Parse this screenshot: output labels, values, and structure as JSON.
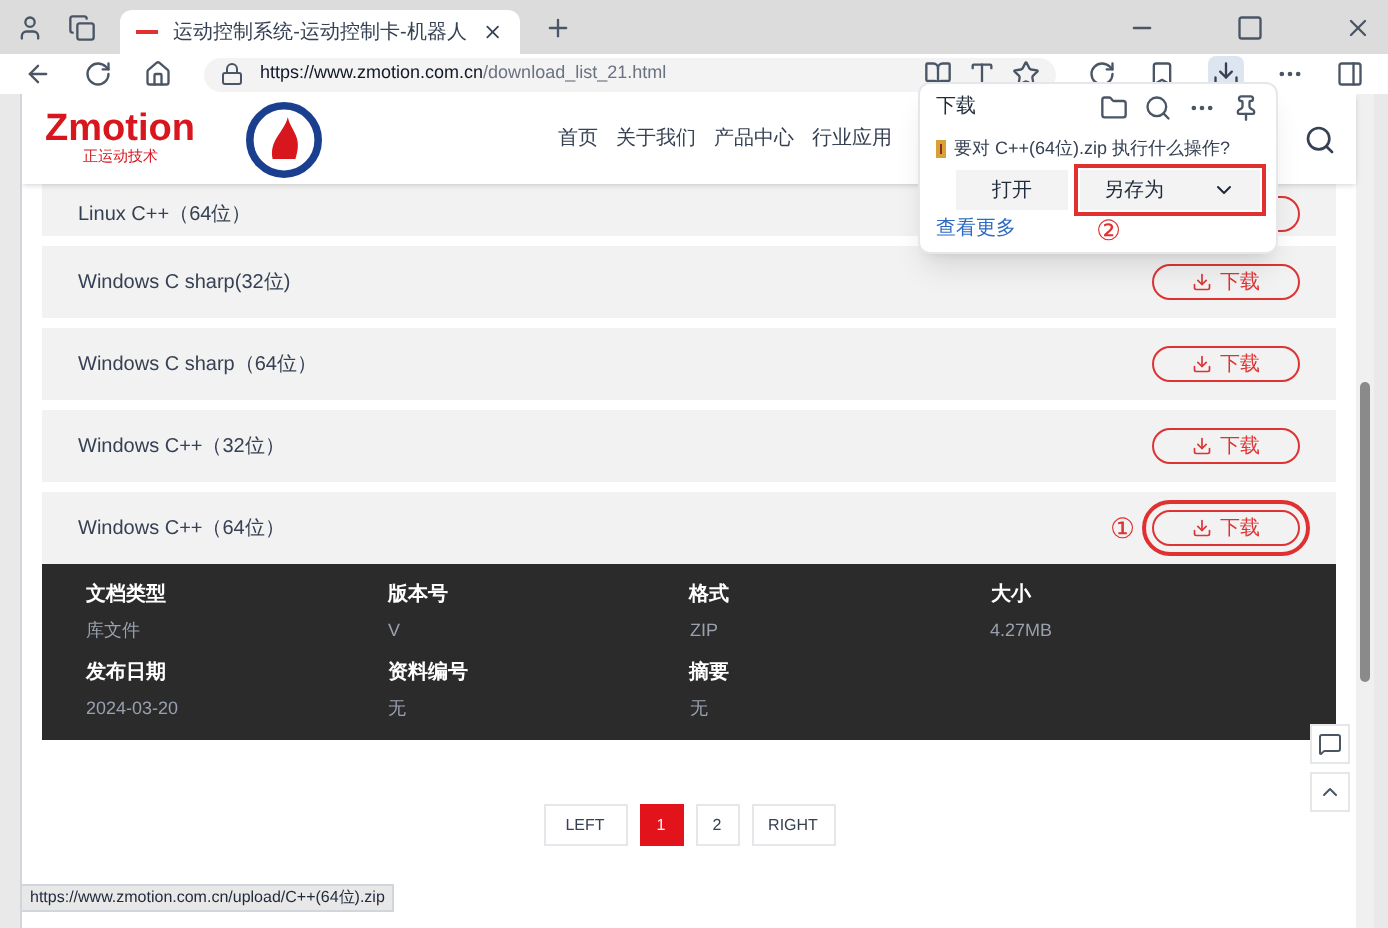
{
  "browser": {
    "tab_title": "运动控制系统-运动控制卡-机器人",
    "url_host": "https://www.zmotion.com.cn",
    "url_path": "/download_list_21.html"
  },
  "site": {
    "logo": "Zmotion",
    "logo_sub": "正运动技术",
    "nav": [
      "首页",
      "关于我们",
      "产品中心",
      "行业应用"
    ]
  },
  "downloads": [
    {
      "name": "Linux C++（64位）",
      "expanded": false
    },
    {
      "name": "Windows C sharp(32位)",
      "button": "下载",
      "expanded": false
    },
    {
      "name": "Windows C sharp（64位）",
      "button": "下载",
      "expanded": false
    },
    {
      "name": "Windows C++（32位）",
      "button": "下载",
      "expanded": false
    },
    {
      "name": "Windows C++（64位）",
      "button": "下载",
      "expanded": true,
      "callout": "①",
      "details": [
        {
          "label": "文档类型",
          "value": "库文件"
        },
        {
          "label": "版本号",
          "value": "V"
        },
        {
          "label": "格式",
          "value": "ZIP"
        },
        {
          "label": "大小",
          "value": "4.27MB"
        },
        {
          "label": "发布日期",
          "value": "2024-03-20"
        },
        {
          "label": "资料编号",
          "value": "无"
        },
        {
          "label": "摘要",
          "value": "无"
        }
      ]
    }
  ],
  "pagination": [
    {
      "label": "LEFT",
      "selected": false
    },
    {
      "label": "1",
      "selected": true
    },
    {
      "label": "2",
      "selected": false
    },
    {
      "label": "RIGHT",
      "selected": false
    }
  ],
  "download_popup": {
    "title": "下载",
    "prompt": "要对 C++(64位).zip 执行什么操作?",
    "open": "打开",
    "save_as": "另存为",
    "more": "查看更多",
    "callout": "②"
  },
  "status_url": "https://www.zmotion.com.cn/upload/C++(64位).zip"
}
